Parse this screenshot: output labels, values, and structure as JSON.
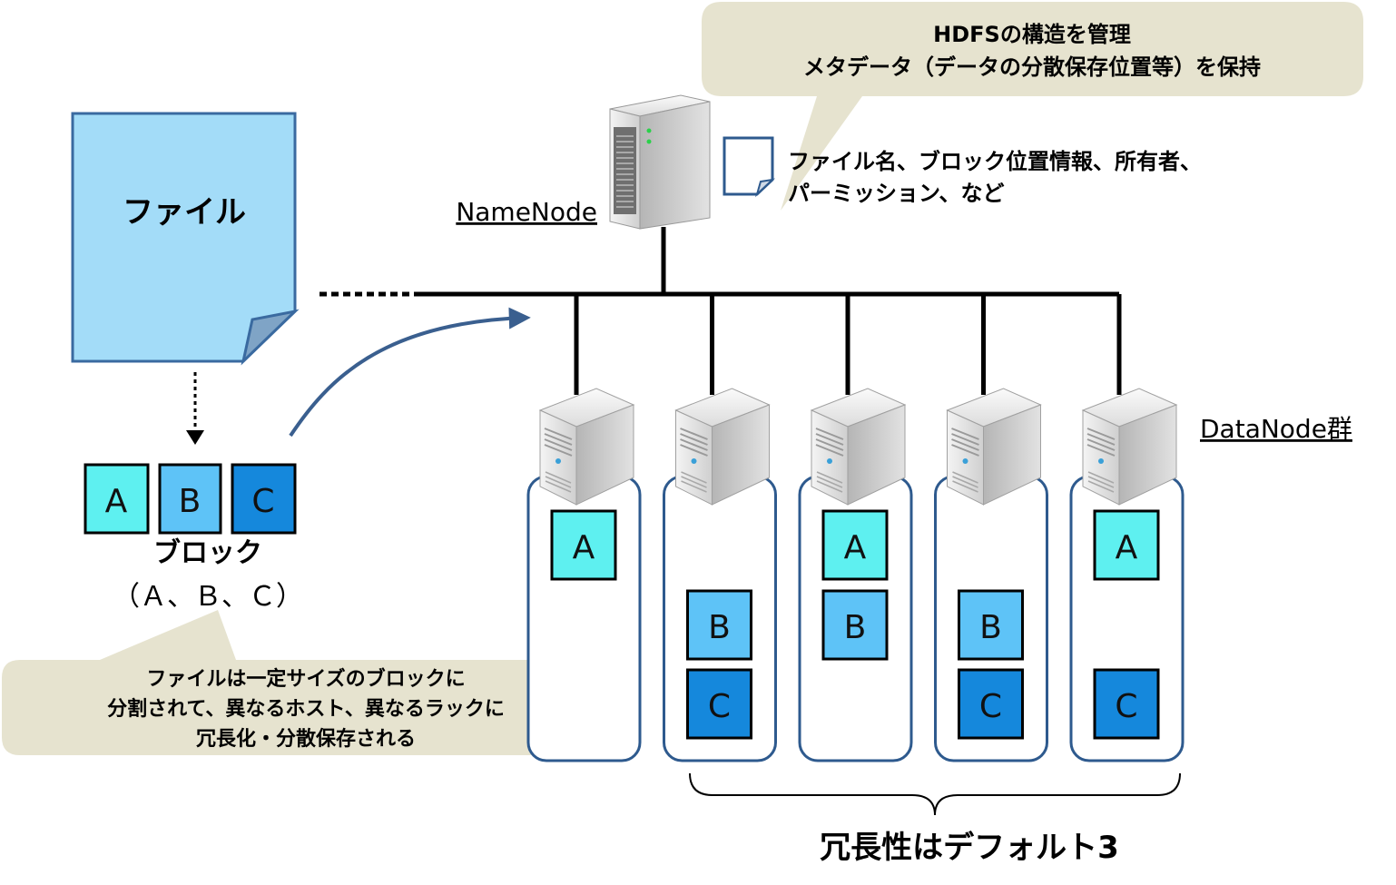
{
  "file": {
    "label": "ファイル"
  },
  "blocks": {
    "items": [
      {
        "label": "A",
        "color": "#5ef0f0"
      },
      {
        "label": "B",
        "color": "#5ec3f7"
      },
      {
        "label": "C",
        "color": "#1588dc"
      }
    ],
    "title": "ブロック",
    "subtitle": "（Ａ、Ｂ、Ｃ）"
  },
  "callout_file": {
    "lines": [
      "ファイルは一定サイズのブロックに",
      "分割されて、異なるホスト、異なるラックに",
      "冗長化・分散保存される"
    ]
  },
  "namenode": {
    "label": "NameNode",
    "callout_lines": [
      "HDFSの構造を管理",
      "メタデータ（データの分散保存位置等）を保持"
    ],
    "metadata_lines": [
      "ファイル名、ブロック位置情報、所有者、",
      "パーミッション、など"
    ]
  },
  "datanodes": {
    "label": "DataNode群",
    "nodes": [
      {
        "blocks": [
          "A",
          "",
          ""
        ]
      },
      {
        "blocks": [
          "",
          "B",
          "C"
        ]
      },
      {
        "blocks": [
          "A",
          "B",
          ""
        ]
      },
      {
        "blocks": [
          "",
          "B",
          "C"
        ]
      },
      {
        "blocks": [
          "A",
          "",
          "C"
        ]
      }
    ],
    "redundancy_label": "冗長性はデフォルト3"
  },
  "colors": {
    "callout_bg": "#e6e3cf",
    "file_fill": "#a3dcf8",
    "file_stroke": "#3a6aa0",
    "node_stroke": "#2e5a8e",
    "arrow": "#3a5f8f"
  }
}
